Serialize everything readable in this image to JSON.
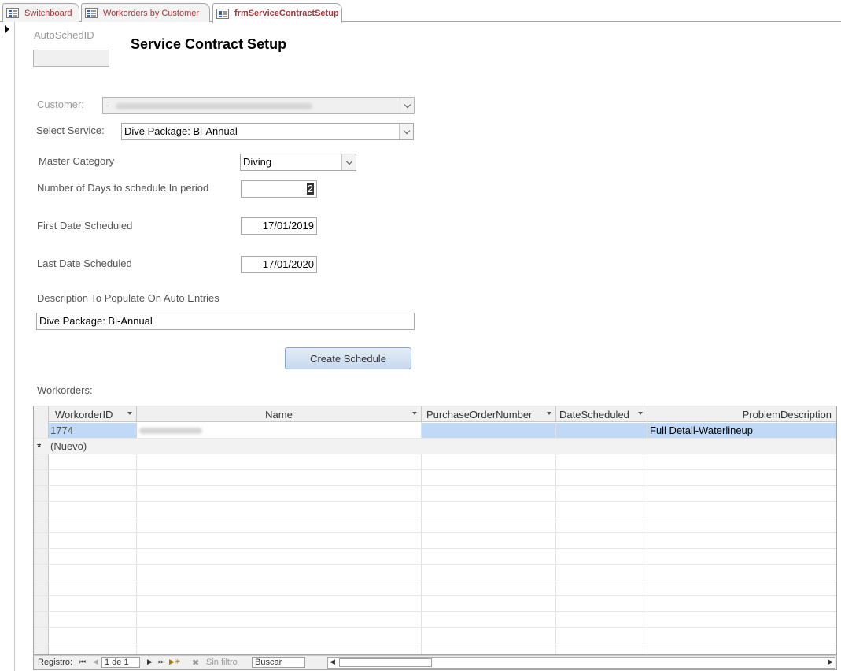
{
  "tabs": [
    {
      "label": "Switchboard",
      "active": false
    },
    {
      "label": "Workorders by Customer",
      "active": false
    },
    {
      "label": "frmServiceContractSetup",
      "active": true
    }
  ],
  "form": {
    "title": "Service Contract Setup",
    "autosched_label": "AutoSchedID",
    "autosched_value": "",
    "customer_label": "Customer:",
    "customer_value_prefix": "-",
    "select_service_label": "Select Service:",
    "select_service_value": "Dive Package: Bi-Annual",
    "master_category_label": "Master Category",
    "master_category_value": "Diving",
    "days_label": "Number of Days to schedule In period",
    "days_value": "2",
    "first_date_label": "First Date Scheduled",
    "first_date_value": "17/01/2019",
    "last_date_label": "Last Date Scheduled",
    "last_date_value": "17/01/2020",
    "description_label": "Description To Populate On Auto Entries",
    "description_value": "Dive Package: Bi-Annual",
    "create_button": "Create Schedule",
    "workorders_label": "Workorders:"
  },
  "datasheet": {
    "columns": [
      "WorkorderID",
      "Name",
      "PurchaseOrderNumber",
      "DateScheduled",
      "ProblemDescription"
    ],
    "rows": [
      {
        "WorkorderID": "1774",
        "Name": "",
        "PurchaseOrderNumber": "",
        "DateScheduled": "",
        "ProblemDescription": "Full Detail-Waterlineup"
      }
    ],
    "new_row_marker": "*",
    "new_row_label": "(Nuevo)"
  },
  "navigation": {
    "record_label": "Registro:",
    "record_value": "1 de 1",
    "filter_label": "Sin filtro",
    "search_placeholder": "Buscar"
  },
  "colors": {
    "tab_text": "#a4373a",
    "selected_row": "#bfd9f6",
    "button": "#c7d8ee"
  }
}
